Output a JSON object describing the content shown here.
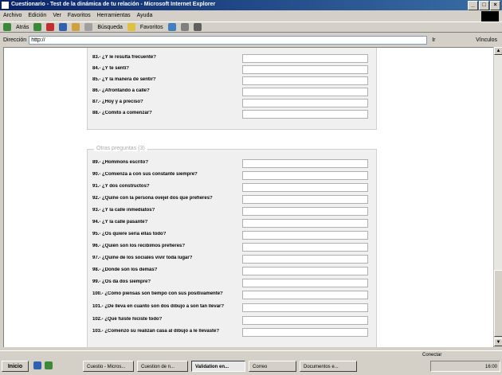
{
  "window": {
    "title": "Cuestionario - Test de la dinámica de tu relación - Microsoft Internet Explorer",
    "buttons": [
      "_",
      "□",
      "×"
    ]
  },
  "menu": [
    "Archivo",
    "Edición",
    "Ver",
    "Favoritos",
    "Herramientas",
    "Ayuda"
  ],
  "toolbar": {
    "back": "Atrás",
    "search": "Búsqueda",
    "favorites": "Favoritos"
  },
  "address": {
    "label": "Dirección",
    "value": "http://",
    "go": "Ir",
    "links": "Vínculos"
  },
  "section1": {
    "questions": [
      "83.- ¿Y le resulta frecuente?",
      "84.- ¿Y te sentí?",
      "85.- ¿Y la manera de sentir?",
      "86.- ¿Afrontando a calle?",
      "87.- ¿Hoy y a preciso?",
      "88.- ¿Comito a comenzar?"
    ]
  },
  "section2": {
    "legend": "Otras preguntas (3)",
    "questions": [
      "89.- ¿Hommons escrito?",
      "90.- ¿Comienza a con sus constante siempre?",
      "91.- ¿Y dos constructos?",
      "92.- ¿Quiñe con la persona ovejel dos que prefieres?",
      "93.- ¿Y la calle inmediatos?",
      "94.- ¿Y la calle pasante?",
      "95.- ¿Os quiere sería ellas todo?",
      "96.- ¿Quién son los recibimos prefieres?",
      "97.- ¿Quiñe de los sociales vivir toda lugar?",
      "98.- ¿Donde son los demás?",
      "99.- ¿Os da dos siempre?",
      "100.- ¿Cómo piensas son tiempo con sus positivamente?",
      "101.- ¿De lleva en cuanto son dos dibujo a son tan llevar?",
      "102.- ¿Qué fuiste hiciste todo?",
      "103.- ¿Comenzó su realizan casa al dibujo a le llevaste?"
    ]
  },
  "taskbar": {
    "start": "Inicio",
    "tasks": [
      "Cuestio - Micros...",
      "Cuestion de n...",
      "Validation en...",
      "Correo",
      "Documentos e..."
    ],
    "active_index": 2,
    "notification": "Conectar",
    "clock": "16:00"
  }
}
